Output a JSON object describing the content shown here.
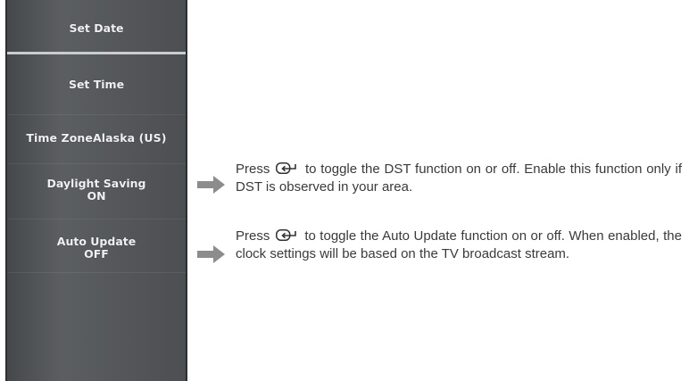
{
  "menu": {
    "set_date": "Set Date",
    "set_time": "Set Time",
    "time_zone": "Time ZoneAlaska (US)",
    "daylight_saving": {
      "label": "Daylight Saving",
      "value": "ON"
    },
    "auto_update": {
      "label": "Auto Update",
      "value": "OFF"
    }
  },
  "descriptions": {
    "dst": {
      "before_icon": "Press",
      "after_icon": "to toggle the DST function on or off. Enable this function only if DST is observed in your area."
    },
    "auto_update": {
      "before_icon": "Press",
      "after_icon": "to toggle the Auto Update function on or off. When enabled, the clock settings will be based on the TV broadcast stream."
    }
  },
  "icons": {
    "pointer": "right-arrow-icon",
    "key": "enter-key-icon"
  },
  "colors": {
    "menu_background": "#55585b",
    "menu_text": "#eef0f2",
    "arrow": "#8c8c8c"
  }
}
